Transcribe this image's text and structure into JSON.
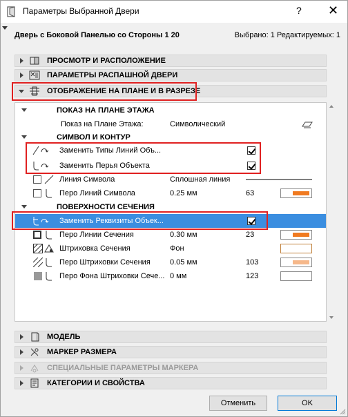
{
  "window": {
    "title": "Параметры Выбранной Двери",
    "help_label": "?",
    "close_label": "✕"
  },
  "header": {
    "object_name": "Дверь с Боковой Панелью со Стороны 1 20",
    "selection_info": "Выбрано: 1 Редактируемых: 1"
  },
  "sections": {
    "preview": "ПРОСМОТР И РАСПОЛОЖЕНИЕ",
    "door_params": "ПАРАМЕТРЫ РАСПАШНОЙ ДВЕРИ",
    "floor_plan": "ОТОБРАЖЕНИЕ НА ПЛАНЕ И В РАЗРЕЗЕ",
    "model": "МОДЕЛЬ",
    "dimension_marker": "МАРКЕР РАЗМЕРА",
    "special_marker": "СПЕЦИАЛЬНЫЕ ПАРАМЕТРЫ МАРКЕРА",
    "categories": "КАТЕГОРИИ И СВОЙСТВА"
  },
  "panel": {
    "show_on_floor": {
      "heading": "ПОКАЗ НА ПЛАНЕ ЭТАЖА",
      "label": "Показ на Плане Этажа:",
      "value": "Символический"
    },
    "symbol_contour": {
      "heading": "СИМВОЛ И КОНТУР",
      "override_line_types": "Заменить Типы Линий Объ...",
      "override_pens": "Заменить Перья Объекта",
      "symbol_line": {
        "label": "Линия Символа",
        "value": "Сплошная линия"
      },
      "symbol_line_pen": {
        "label": "Перо Линий Символа",
        "value": "0.25 мм",
        "num": "63"
      }
    },
    "cut_surfaces": {
      "heading": "ПОВЕРХНОСТИ СЕЧЕНИЯ",
      "override_attributes": "Заменить Реквизиты Объек...",
      "cut_line_pen": {
        "label": "Перо Линии Сечения",
        "value": "0.30 мм",
        "num": "23"
      },
      "cut_fill": {
        "label": "Штриховка Сечения",
        "value": "Фон"
      },
      "cut_fill_pen": {
        "label": "Перо Штриховки Сечения",
        "value": "0.05 мм",
        "num": "103"
      },
      "cut_fill_bg_pen": {
        "label": "Перо Фона Штриховки Сече...",
        "value": "0 мм",
        "num": "123"
      }
    }
  },
  "buttons": {
    "cancel": "Отменить",
    "ok": "OK"
  },
  "colors": {
    "selection": "#3b8ee0",
    "highlight": "#e02020",
    "pen_orange": "#f07a20",
    "pen_light": "#f6b88a"
  }
}
